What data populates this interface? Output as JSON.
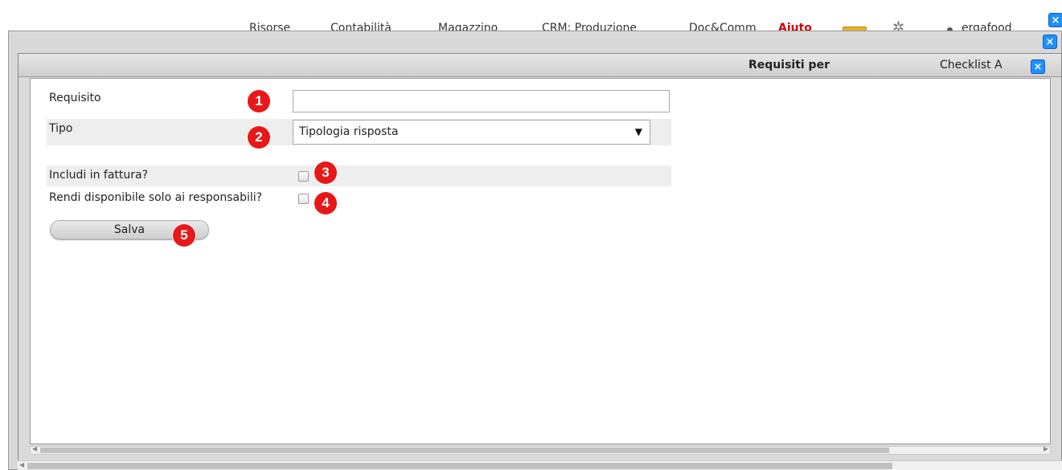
{
  "topnav": {
    "items": [
      "Risorse",
      "Contabilità",
      "Magazzino",
      "CRM; Produzione",
      "Doc&Comm"
    ],
    "help": "Aiuto",
    "user": "ergafood",
    "gear_icon": "gear-icon",
    "mail_icon": "mail-icon"
  },
  "close_glyph": "×",
  "inner_dialog": {
    "title_main": "Requisiti per",
    "title_right": "Checklist A"
  },
  "form": {
    "requisito_label": "Requisito",
    "requisito_value": "",
    "tipo_label": "Tipo",
    "tipo_selected": "Tipologia risposta",
    "fattura_label": "Includi in fattura?",
    "fattura_checked": false,
    "responsabili_label": "Rendi disponibile solo ai responsabili?",
    "responsabili_checked": false,
    "save_label": "Salva"
  },
  "annotations": [
    "1",
    "2",
    "3",
    "4",
    "5"
  ],
  "colors": {
    "badge": "#e81818",
    "close_button": "#1e90ff",
    "help_link": "#d40000"
  }
}
